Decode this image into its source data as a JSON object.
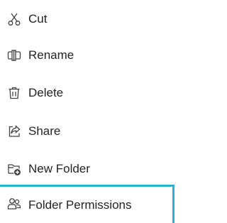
{
  "menu": {
    "items": [
      {
        "label": "Cut",
        "icon": "scissors-icon"
      },
      {
        "label": "Rename",
        "icon": "rename-icon"
      },
      {
        "label": "Delete",
        "icon": "trash-icon"
      },
      {
        "label": "Share",
        "icon": "share-icon"
      },
      {
        "label": "New Folder",
        "icon": "new-folder-icon"
      },
      {
        "label": "Folder Permissions",
        "icon": "people-icon"
      }
    ],
    "focus_color": "#27b3d6",
    "icon_color": "#424242",
    "text_color": "#242424",
    "new_folder_badge_color": "#424242"
  }
}
